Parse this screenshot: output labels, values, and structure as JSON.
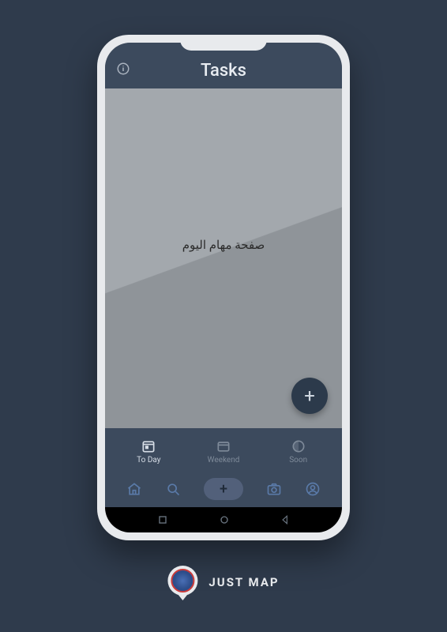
{
  "header": {
    "title": "Tasks"
  },
  "content": {
    "empty_text": "صفحة مهام اليوم"
  },
  "fab": {
    "label": "+"
  },
  "tabs": [
    {
      "label": "To Day",
      "active": true
    },
    {
      "label": "Weekend",
      "active": false
    },
    {
      "label": "Soon",
      "active": false
    }
  ],
  "bottomnav": {
    "add_label": "+"
  },
  "footer": {
    "brand": "JUST MAP"
  }
}
